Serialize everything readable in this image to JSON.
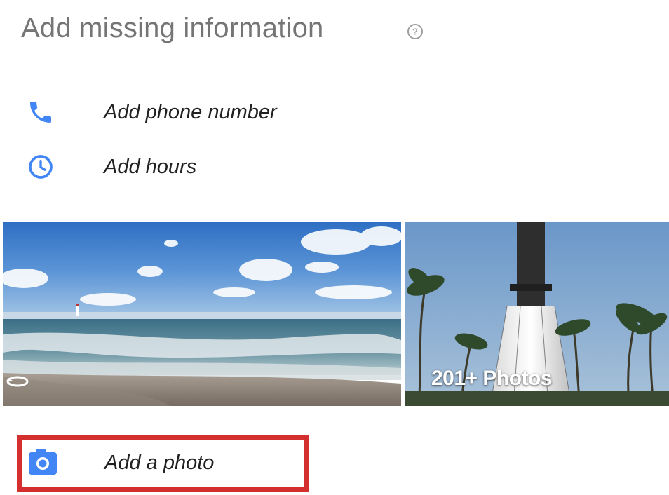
{
  "header": {
    "title": "Add missing information",
    "help_icon": "help-circle-icon"
  },
  "actions": [
    {
      "label": "Add phone number",
      "icon": "phone-icon"
    },
    {
      "label": "Add hours",
      "icon": "clock-icon"
    }
  ],
  "photos": {
    "count_label": "201+ Photos",
    "panorama_icon": "panorama-icon"
  },
  "add_photo": {
    "label": "Add a photo",
    "icon": "camera-icon"
  },
  "colors": {
    "accent": "#4285f4",
    "title_text": "#757575",
    "highlight_border": "#d32f2f"
  }
}
